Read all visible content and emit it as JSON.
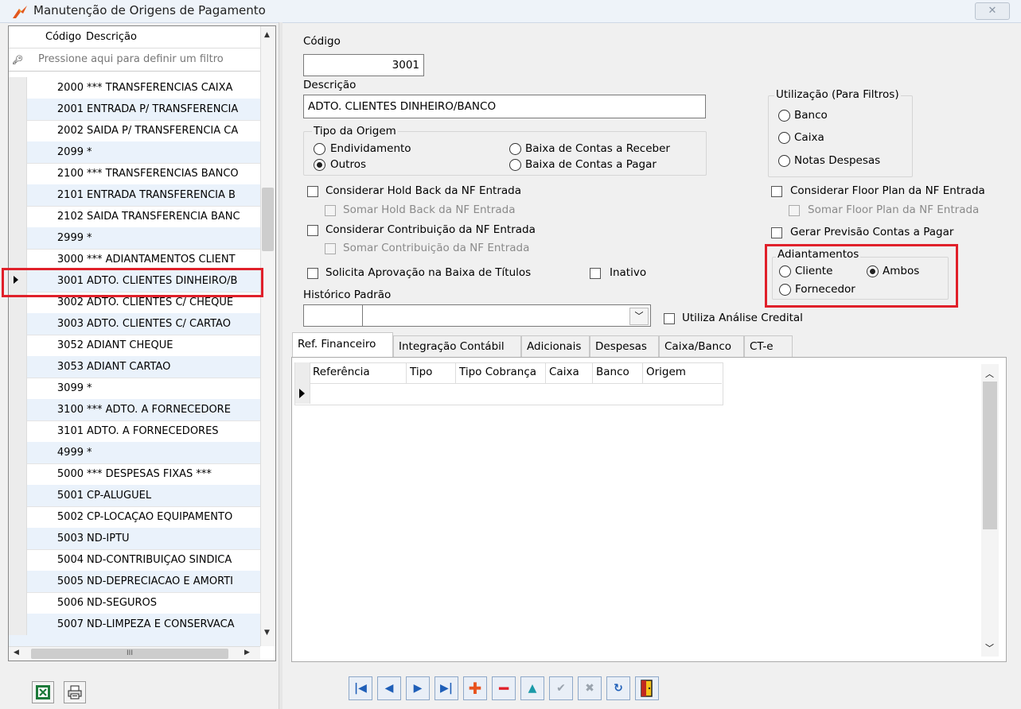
{
  "window": {
    "title": "Manutenção de Origens de Pagamento",
    "close_glyph": "☒"
  },
  "left_grid": {
    "col_codigo": "Código",
    "col_descricao": "Descrição",
    "filter_placeholder": "Pressione aqui para definir um filtro",
    "rows": [
      {
        "codigo": "2000",
        "descricao": "*** TRANSFERENCIAS CAIXA"
      },
      {
        "codigo": "2001",
        "descricao": "ENTRADA P/ TRANSFERENCIA"
      },
      {
        "codigo": "2002",
        "descricao": "SAIDA P/ TRANSFERENCIA CA"
      },
      {
        "codigo": "2099",
        "descricao": "*"
      },
      {
        "codigo": "2100",
        "descricao": "*** TRANSFERENCIAS BANCO"
      },
      {
        "codigo": "2101",
        "descricao": "ENTRADA TRANSFERENCIA B"
      },
      {
        "codigo": "2102",
        "descricao": "SAIDA TRANSFERENCIA BANC"
      },
      {
        "codigo": "2999",
        "descricao": "*"
      },
      {
        "codigo": "3000",
        "descricao": "*** ADIANTAMENTOS CLIENT"
      },
      {
        "codigo": "3001",
        "descricao": "ADTO. CLIENTES DINHEIRO/B"
      },
      {
        "codigo": "3002",
        "descricao": "ADTO. CLIENTES C/ CHEQUE"
      },
      {
        "codigo": "3003",
        "descricao": "ADTO. CLIENTES C/ CARTÃO"
      },
      {
        "codigo": "3052",
        "descricao": "ADIANT CHEQUE"
      },
      {
        "codigo": "3053",
        "descricao": "ADIANT CARTAO"
      },
      {
        "codigo": "3099",
        "descricao": "*"
      },
      {
        "codigo": "3100",
        "descricao": "*** ADTO. A FORNECEDORE"
      },
      {
        "codigo": "3101",
        "descricao": "ADTO. A FORNECEDORES"
      },
      {
        "codigo": "4999",
        "descricao": "*"
      },
      {
        "codigo": "5000",
        "descricao": "*** DESPESAS FIXAS ***"
      },
      {
        "codigo": "5001",
        "descricao": "CP-ALUGUEL"
      },
      {
        "codigo": "5002",
        "descricao": "CP-LOCAÇÃO EQUIPAMENTO"
      },
      {
        "codigo": "5003",
        "descricao": "ND-IPTU"
      },
      {
        "codigo": "5004",
        "descricao": "ND-CONTRIBUIÇÃO SINDICA"
      },
      {
        "codigo": "5005",
        "descricao": "ND-DEPRECIACAO E AMORTI"
      },
      {
        "codigo": "5006",
        "descricao": "ND-SEGUROS"
      },
      {
        "codigo": "5007",
        "descricao": "ND-LIMPEZA E CONSERVACA"
      }
    ],
    "hscroll_mid": "III"
  },
  "form": {
    "codigo_label": "Código",
    "codigo_value": "3001",
    "descricao_label": "Descrição",
    "descricao_value": "ADTO. CLIENTES DINHEIRO/BANCO",
    "tipo_origem": {
      "title": "Tipo da Origem",
      "endividamento": "Endividamento",
      "outros": "Outros",
      "baixa_receber": "Baixa de Contas a Receber",
      "baixa_pagar": "Baixa de Contas a Pagar"
    },
    "utilizacao": {
      "title": "Utilização (Para Filtros)",
      "banco": "Banco",
      "caixa": "Caixa",
      "notas": "Notas Despesas"
    },
    "considerar_hold_back": "Considerar Hold Back da NF Entrada",
    "somar_hold_back": "Somar Hold Back da NF Entrada",
    "considerar_contribuicao": "Considerar Contribuição da NF Entrada",
    "somar_contribuicao": "Somar Contribuição da NF Entrada",
    "solicita_aprovacao": "Solicita Aprovação na Baixa de Títulos",
    "inativo": "Inativo",
    "considerar_floor_plan": "Considerar Floor Plan da NF Entrada",
    "somar_floor_plan": "Somar Floor Plan da NF Entrada",
    "gerar_previsao": "Gerar Previsão Contas a Pagar",
    "adiantamentos": {
      "title": "Adiantamentos",
      "cliente": "Cliente",
      "ambos": "Ambos",
      "fornecedor": "Fornecedor"
    },
    "historico_label": "Histórico Padrão",
    "historico_code": "",
    "historico_desc": "",
    "utiliza_analise": "Utiliza Análise Credital"
  },
  "tabs": [
    "Ref. Financeiro",
    "Integração Contábil",
    "Adicionais",
    "Despesas",
    "Caixa/Banco",
    "CT-e"
  ],
  "ref_grid": {
    "headers": [
      "Referência",
      "Tipo",
      "Tipo Cobrança",
      "Caixa",
      "Banco",
      "Origem"
    ]
  },
  "colors": {
    "highlight": "#e0202a",
    "row_alt": "#eaf2fb"
  }
}
